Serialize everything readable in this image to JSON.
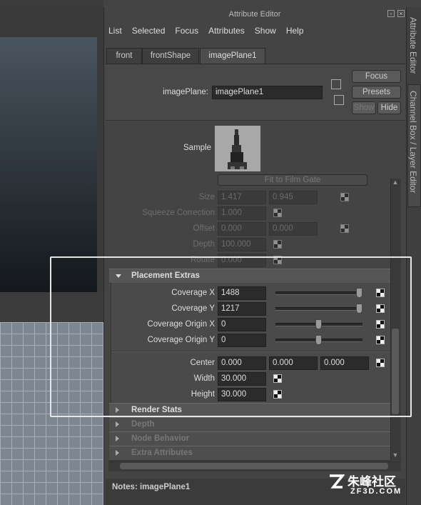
{
  "window": {
    "title": "Attribute Editor"
  },
  "menu": [
    "List",
    "Selected",
    "Focus",
    "Attributes",
    "Show",
    "Help"
  ],
  "tabs": [
    "front",
    "frontShape",
    "imagePlane1"
  ],
  "header": {
    "node_label": "imagePlane:",
    "node_value": "imagePlane1",
    "focus_button": "Focus",
    "presets_button": "Presets",
    "show_button": "Show",
    "hide_button": "Hide"
  },
  "sample": {
    "label": "Sample"
  },
  "upper": {
    "fit_button": "Fit to Film Gate",
    "size_label": "Size",
    "size_x": "1.417",
    "size_y": "0.945",
    "squeeze_label": "Squeeze Correction",
    "squeeze_value": "1.000",
    "offset_label": "Offset",
    "offset_x": "0.000",
    "offset_y": "0.000",
    "depth_label": "Depth",
    "depth_value": "100.000",
    "rotate_label": "Rotate",
    "rotate_value": "0.000"
  },
  "placement": {
    "title": "Placement Extras",
    "coverage_x_label": "Coverage X",
    "coverage_x": "1488",
    "coverage_y_label": "Coverage Y",
    "coverage_y": "1217",
    "origin_x_label": "Coverage Origin X",
    "origin_x": "0",
    "origin_y_label": "Coverage Origin Y",
    "origin_y": "0",
    "center_label": "Center",
    "center_x": "0.000",
    "center_y": "0.000",
    "center_z": "0.000",
    "width_label": "Width",
    "width_value": "30.000",
    "height_label": "Height",
    "height_value": "30.000"
  },
  "sections": [
    "Render Stats",
    "Depth",
    "Node Behavior",
    "Extra Attributes"
  ],
  "notes": {
    "label": "Notes:  imagePlane1"
  },
  "side_tabs": [
    "Attribute Editor",
    "Channel Box / Layer Editor"
  ],
  "watermark": {
    "brand": "朱峰社区",
    "site": "ZF3D.COM"
  }
}
